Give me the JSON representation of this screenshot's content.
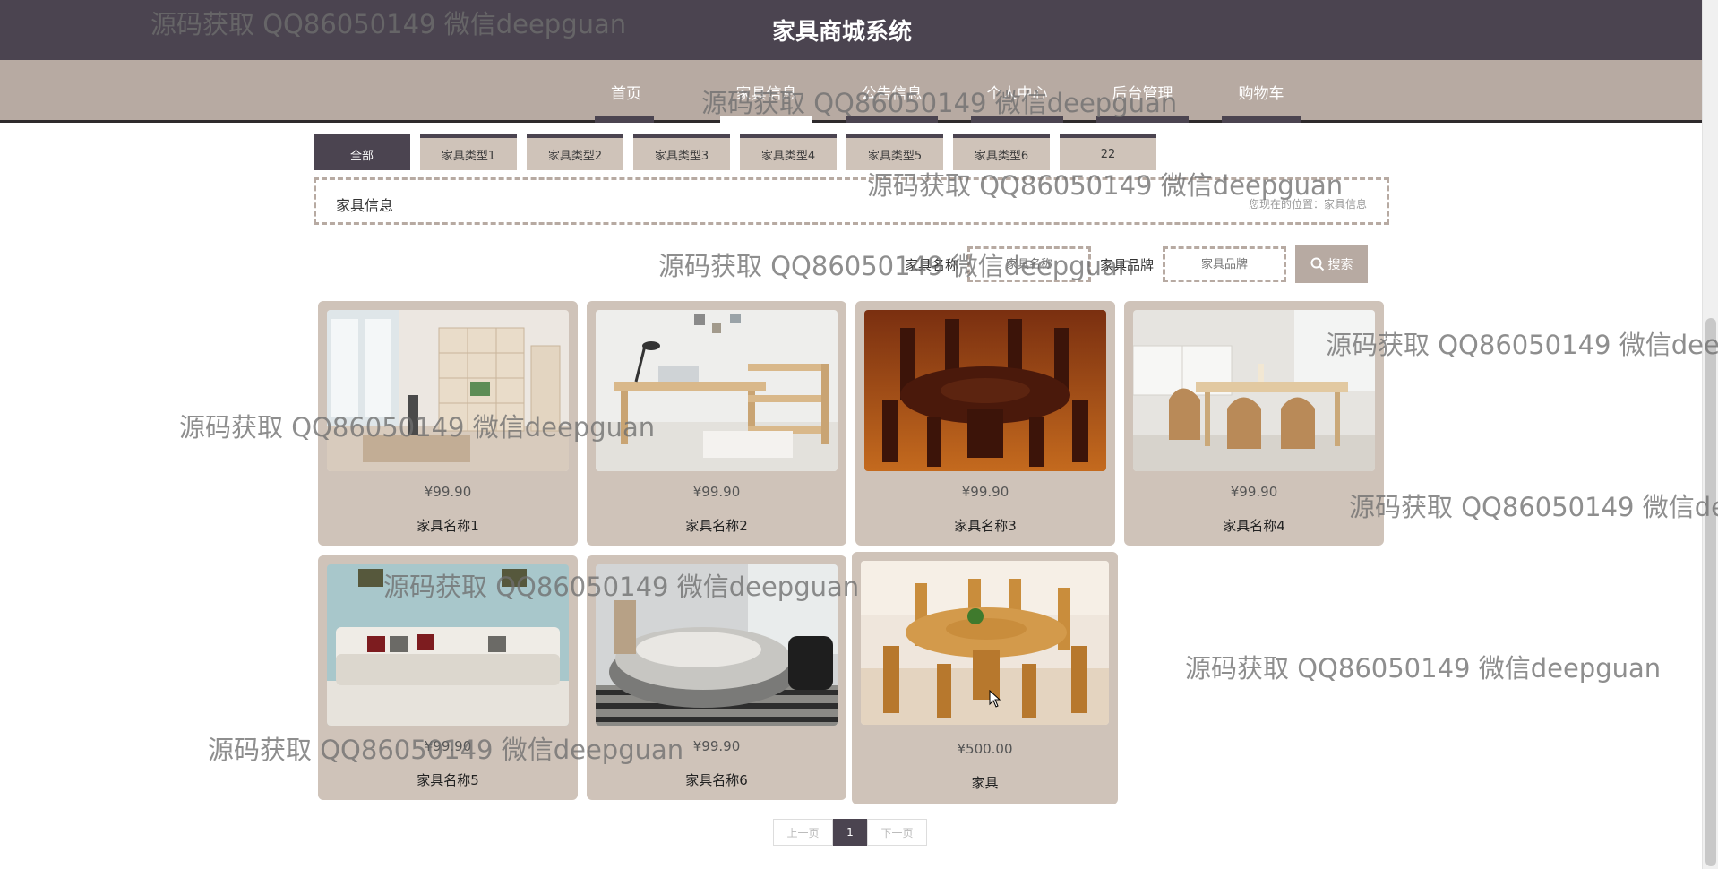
{
  "header": {
    "title": "家具商城系统"
  },
  "nav": {
    "items": [
      {
        "label": "首页",
        "active": false
      },
      {
        "label": "家具信息",
        "active": true
      },
      {
        "label": "公告信息",
        "active": false
      },
      {
        "label": "个人中心",
        "active": false
      },
      {
        "label": "后台管理",
        "active": false
      },
      {
        "label": "购物车",
        "active": false
      }
    ]
  },
  "filters": [
    "全部",
    "家具类型1",
    "家具类型2",
    "家具类型3",
    "家具类型4",
    "家具类型5",
    "家具类型6",
    "22"
  ],
  "section": {
    "title": "家具信息",
    "breadcrumb": "您现在的位置：家具信息"
  },
  "search": {
    "name_label": "家具名称",
    "name_placeholder": "家具名称",
    "brand_label": "家具品牌",
    "brand_placeholder": "家具品牌",
    "button_label": "搜索"
  },
  "products": [
    {
      "name": "家具名称1",
      "price": "¥99.90",
      "image": "bookshelf-desk-photo"
    },
    {
      "name": "家具名称2",
      "price": "¥99.90",
      "image": "wooden-desk-photo"
    },
    {
      "name": "家具名称3",
      "price": "¥99.90",
      "image": "round-dining-set-photo"
    },
    {
      "name": "家具名称4",
      "price": "¥99.90",
      "image": "dining-table-photo"
    },
    {
      "name": "家具名称5",
      "price": "¥99.90",
      "image": "sofa-photo"
    },
    {
      "name": "家具名称6",
      "price": "¥99.90",
      "image": "round-bed-photo"
    },
    {
      "name": "家具",
      "price": "¥500.00",
      "image": "wooden-round-table-photo"
    }
  ],
  "pagination": {
    "prev": "上一页",
    "current": "1",
    "next": "下一页"
  },
  "watermark": "源码获取 QQ86050149 微信deepguan",
  "colors": {
    "header_bg": "#4b4450",
    "nav_bg": "#b7aaa2",
    "card_bg": "#cfc3b9",
    "accent": "#4b4450"
  }
}
